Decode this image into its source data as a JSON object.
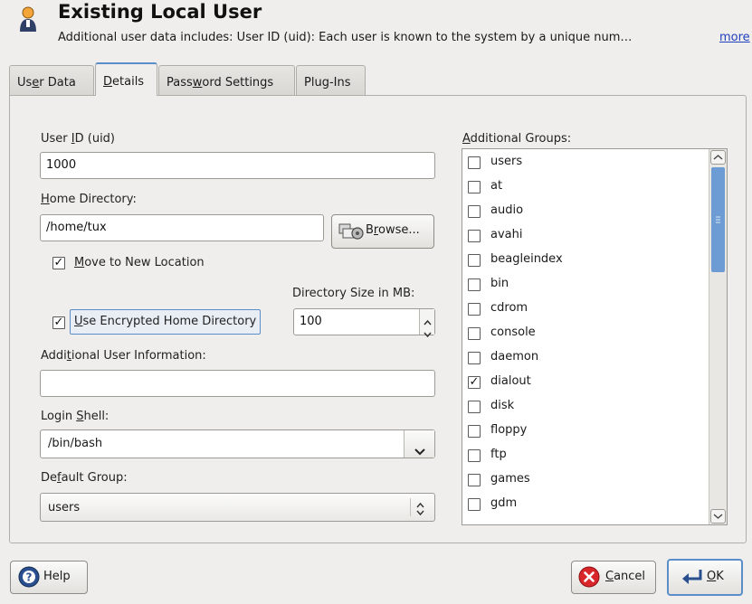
{
  "header": {
    "title": "Existing Local User",
    "description": "Additional user data includes: User ID (uid): Each user is known to the system by a unique num…",
    "more_link": "more"
  },
  "tabs": [
    {
      "pre": "Us",
      "u": "e",
      "post": "r Data"
    },
    {
      "pre": "",
      "u": "D",
      "post": "etails"
    },
    {
      "pre": "Pass",
      "u": "w",
      "post": "ord Settings"
    },
    {
      "pre": "Plug-Ins",
      "u": "",
      "post": ""
    }
  ],
  "details": {
    "uid_label": {
      "pre": "User ",
      "u": "I",
      "post": "D (uid)"
    },
    "uid_value": "1000",
    "home_label": {
      "pre": "",
      "u": "H",
      "post": "ome Directory:"
    },
    "home_value": "/home/tux",
    "browse_button": {
      "pre": "B",
      "u": "r",
      "post": "owse..."
    },
    "move_label": {
      "pre": "",
      "u": "M",
      "post": "ove to New Location"
    },
    "move_checked": true,
    "dir_size_label": "Directory Size in MB:",
    "dir_size_value": "100",
    "encrypted_label": {
      "pre": "",
      "u": "U",
      "post": "se Encrypted Home Directory"
    },
    "encrypted_checked": true,
    "addinfo_label": {
      "pre": "Addi",
      "u": "t",
      "post": "ional User Information:"
    },
    "addinfo_value": "",
    "shell_label": {
      "pre": "Login ",
      "u": "S",
      "post": "hell:"
    },
    "shell_value": "/bin/bash",
    "group_label": {
      "pre": "De",
      "u": "f",
      "post": "ault Group:"
    },
    "group_value": "users",
    "additional_groups_label": {
      "pre": "",
      "u": "A",
      "post": "dditional Groups:"
    },
    "groups": [
      {
        "name": "users",
        "checked": false
      },
      {
        "name": "at",
        "checked": false
      },
      {
        "name": "audio",
        "checked": false
      },
      {
        "name": "avahi",
        "checked": false
      },
      {
        "name": "beagleindex",
        "checked": false
      },
      {
        "name": "bin",
        "checked": false
      },
      {
        "name": "cdrom",
        "checked": false
      },
      {
        "name": "console",
        "checked": false
      },
      {
        "name": "daemon",
        "checked": false
      },
      {
        "name": "dialout",
        "checked": true
      },
      {
        "name": "disk",
        "checked": false
      },
      {
        "name": "floppy",
        "checked": false
      },
      {
        "name": "ftp",
        "checked": false
      },
      {
        "name": "games",
        "checked": false
      },
      {
        "name": "gdm",
        "checked": false
      }
    ]
  },
  "footer": {
    "help_button": "Help",
    "cancel_button": {
      "pre": "",
      "u": "C",
      "post": "ancel"
    },
    "ok_button": {
      "pre": "",
      "u": "O",
      "post": "K"
    }
  },
  "colors": {
    "accent": "#5b8ec9",
    "link": "#1f3fbf",
    "scrollbar_thumb": "#6d9bd3"
  },
  "icons": [
    "user-icon",
    "browse-icon",
    "help-icon",
    "cancel-icon",
    "ok-icon",
    "chevron-down-icon",
    "spin-up-icon",
    "spin-down-icon"
  ]
}
